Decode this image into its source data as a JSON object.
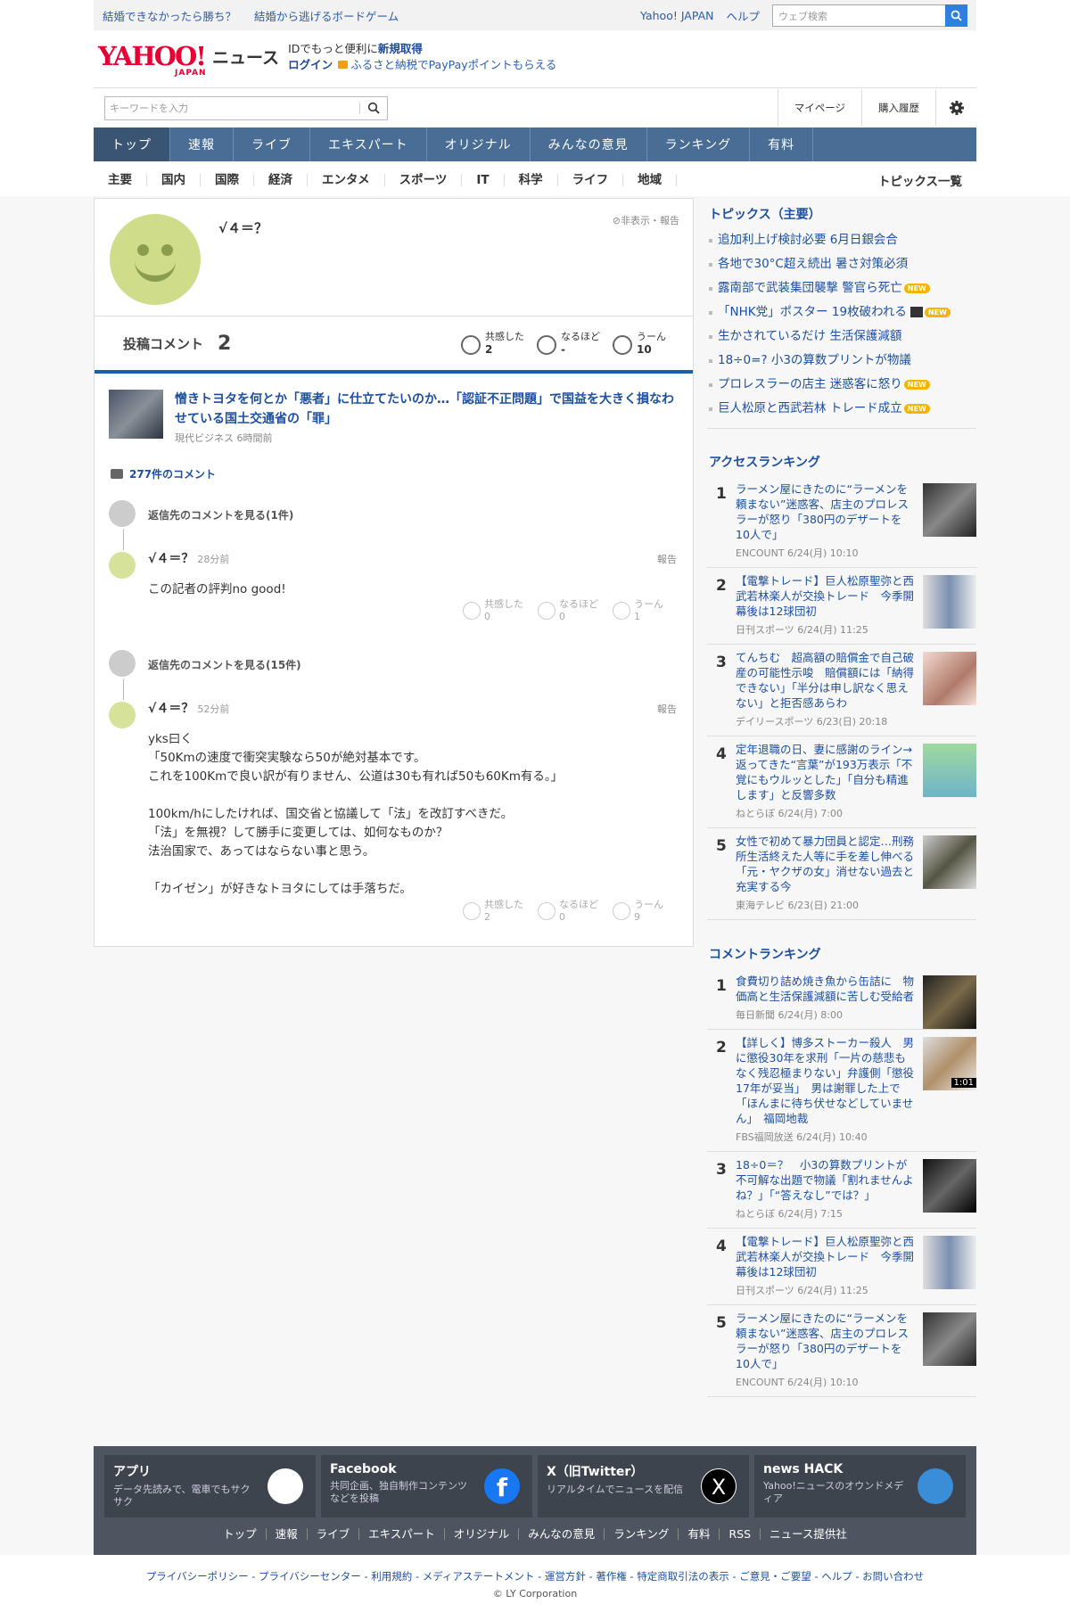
{
  "topbar": {
    "links": [
      "結婚できなかったら勝ち？",
      "結婚から逃げるボードゲーム"
    ],
    "yahoo_japan": "Yahoo! JAPAN",
    "help": "ヘルプ",
    "web_search_placeholder": "ウェブ検索"
  },
  "header": {
    "logo_text": "YAHOO!",
    "logo_japan": "JAPAN",
    "news": "ニュース",
    "id_prefix": "IDでもっと便利に",
    "signup": "新規取得",
    "login": "ログイン",
    "furusato": "ふるさと納税でPayPayポイントもらえる"
  },
  "search": {
    "placeholder": "キーワードを入力",
    "mypage": "マイページ",
    "history": "購入履歴"
  },
  "nav": [
    "トップ",
    "速報",
    "ライブ",
    "エキスパート",
    "オリジナル",
    "みんなの意見",
    "ランキング",
    "有料"
  ],
  "cats": [
    "主要",
    "国内",
    "国際",
    "経済",
    "エンタメ",
    "スポーツ",
    "IT",
    "科学",
    "ライフ",
    "地域"
  ],
  "topics_list_link": "トピックス一覧",
  "profile": {
    "name": "√４＝？",
    "hide_report": "非表示・報告",
    "posts_label": "投稿コメント",
    "posts_count": "2",
    "reactions": [
      {
        "label": "共感した",
        "value": "2"
      },
      {
        "label": "なるほど",
        "value": "-"
      },
      {
        "label": "うーん",
        "value": "10"
      }
    ]
  },
  "article": {
    "title": "憎きトヨタを何とか「悪者」に仕立てたいのか…「認証不正問題」で国益を大きく損なわせている国土交通省の「罪」",
    "source": "現代ビジネス",
    "time": "6時間前"
  },
  "comment_count": "277件のコメント",
  "threads": [
    {
      "reply_link": "返信先のコメントを見る(1件)",
      "name": "√４＝？",
      "time": "28分前",
      "report": "報告",
      "text": [
        "この記者の評判no good!"
      ],
      "reactions": [
        {
          "label": "共感した",
          "value": "0"
        },
        {
          "label": "なるほど",
          "value": "0"
        },
        {
          "label": "うーん",
          "value": "1"
        }
      ]
    },
    {
      "reply_link": "返信先のコメントを見る(15件)",
      "name": "√４＝？",
      "time": "52分前",
      "report": "報告",
      "text": [
        "yks曰く",
        "「50Kmの速度で衝突実験なら50が絶対基本です。",
        "これを100Kmで良い訳が有りません、公道は30も有れば50も60Km有る。」",
        "",
        "100km/hにしたければ、国交省と協議して「法」を改訂すべきだ。",
        "「法」を無視？して勝手に変更しては、如何なものか？",
        "法治国家で、あってはならない事と思う。",
        "",
        "「カイゼン」が好きなトヨタにしては手落ちだ。"
      ],
      "reactions": [
        {
          "label": "共感した",
          "value": "2"
        },
        {
          "label": "なるほど",
          "value": "0"
        },
        {
          "label": "うーん",
          "value": "9"
        }
      ]
    }
  ],
  "topics": {
    "title": "トピックス（主要）",
    "items": [
      {
        "text": "追加利上げ検討必要 6月日銀会合",
        "new": false,
        "video": false
      },
      {
        "text": "各地で30°C超え続出 暑さ対策必須",
        "new": false,
        "video": false
      },
      {
        "text": "露南部で武装集団襲撃 警官ら死亡",
        "new": true,
        "video": false
      },
      {
        "text": "「NHK党」ポスター 19枚破われる",
        "new": true,
        "video": true
      },
      {
        "text": "生かされているだけ 生活保護減額",
        "new": false,
        "video": false
      },
      {
        "text": "18÷0=? 小3の算数プリントが物議",
        "new": false,
        "video": false
      },
      {
        "text": "プロレスラーの店主 迷惑客に怒り",
        "new": true,
        "video": false
      },
      {
        "text": "巨人松原と西武若林 トレード成立",
        "new": true,
        "video": false
      }
    ],
    "new_badge": "NEW"
  },
  "access_ranking": {
    "title": "アクセスランキング",
    "items": [
      {
        "rank": "1",
        "title": "ラーメン屋にきたのに“ラーメンを頼まない”迷惑客、店主のプロレスラーが怒り「380円のデザートを10人で」",
        "source": "ENCOUNT 6/24(月) 10:10"
      },
      {
        "rank": "2",
        "title": "【電撃トレード】巨人松原聖弥と西武若林楽人が交換トレード　今季開幕後は12球団初",
        "source": "日刊スポーツ 6/24(月) 11:25"
      },
      {
        "rank": "3",
        "title": "てんちむ　超高額の賠償金で自己破産の可能性示唆　賠償額には「納得できない」「半分は申し訳なく思えない」と拒否感あらわ",
        "source": "デイリースポーツ 6/23(日) 20:18"
      },
      {
        "rank": "4",
        "title": "定年退職の日、妻に感謝のライン→返ってきた“言葉”が193万表示「不覚にもウルッとした」「自分も精進します」と反響多数",
        "source": "ねとらぼ 6/24(月) 7:00"
      },
      {
        "rank": "5",
        "title": "女性で初めて暴力団員と認定…刑務所生活終えた人等に手を差し伸べる「元・ヤクザの女」消せない過去と充実する今",
        "source": "東海テレビ 6/23(日) 21:00"
      }
    ]
  },
  "comment_ranking": {
    "title": "コメントランキング",
    "items": [
      {
        "rank": "1",
        "title": "食費切り詰め焼き魚から缶詰に　物価高と生活保護減額に苦しむ受給者",
        "source": "毎日新聞 6/24(月) 8:00"
      },
      {
        "rank": "2",
        "title": "【詳しく】博多ストーカー殺人　男に懲役30年を求刑「一片の慈悲もなく残忍極まりない」弁護側「懲役17年が妥当」　男は謝罪した上で「ほんまに待ち伏せなどしていません」　福岡地裁",
        "source": "FBS福岡放送 6/24(月) 10:40",
        "duration": "1:01"
      },
      {
        "rank": "3",
        "title": "18÷0＝？　小3の算数プリントが不可解な出題で物議「割れませんよね？」「“答えなし”では？」",
        "source": "ねとらぼ 6/24(月) 7:15"
      },
      {
        "rank": "4",
        "title": "【電撃トレード】巨人松原聖弥と西武若林楽人が交換トレード　今季開幕後は12球団初",
        "source": "日刊スポーツ 6/24(月) 11:25"
      },
      {
        "rank": "5",
        "title": "ラーメン屋にきたのに“ラーメンを頼まない”迷惑客、店主のプロレスラーが怒り「380円のデザートを10人で」",
        "source": "ENCOUNT 6/24(月) 10:10"
      }
    ]
  },
  "footer": {
    "cards": [
      {
        "title": "アプリ",
        "desc": "データ先読みで、電車でもサクサク",
        "icon": "app-icon"
      },
      {
        "title": "Facebook",
        "desc": "共同企画、独自制作コンテンツなどを投稿",
        "icon": "facebook-icon"
      },
      {
        "title": "X（旧Twitter）",
        "desc": "リアルタイムでニュースを配信",
        "icon": "x-icon"
      },
      {
        "title": "news HACK",
        "desc": "Yahoo!ニュースのオウンドメディア",
        "icon": "newshack-icon"
      }
    ],
    "links": [
      "トップ",
      "速報",
      "ライブ",
      "エキスパート",
      "オリジナル",
      "みんなの意見",
      "ランキング",
      "有料",
      "RSS",
      "ニュース提供社"
    ],
    "legal": "プライバシーポリシー - プライバシーセンター - 利用規約 - メディアステートメント - 運営方針 - 著作権 - 特定商取引法の表示 - ご意見・ご要望 - ヘルプ - お問い合わせ",
    "copyright": "© LY Corporation"
  },
  "colors": {
    "brand": "#e60033",
    "nav": "#4a6d95",
    "link": "#1d4fa0",
    "accent": "#1d5ea8"
  }
}
